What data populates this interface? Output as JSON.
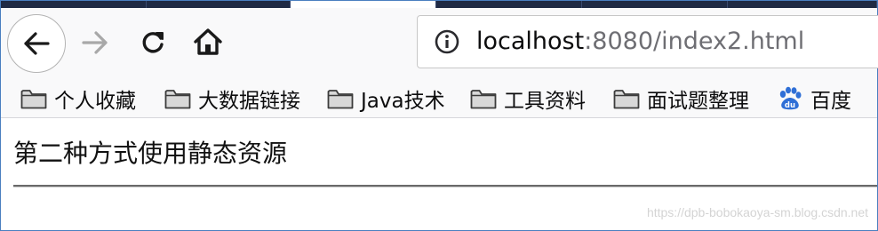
{
  "url": {
    "host": "localhost",
    "rest": ":8080/index2.html"
  },
  "nav": {
    "back_icon": "arrow-left-icon",
    "forward_icon": "arrow-right-icon",
    "reload_icon": "reload-icon",
    "home_icon": "home-icon",
    "info_icon": "info-icon"
  },
  "bookmarks": [
    {
      "label": "个人收藏",
      "icon": "folder-icon"
    },
    {
      "label": "大数据链接",
      "icon": "folder-icon"
    },
    {
      "label": "Java技术",
      "icon": "folder-icon"
    },
    {
      "label": "工具资料",
      "icon": "folder-icon"
    },
    {
      "label": "面试题整理",
      "icon": "folder-icon"
    },
    {
      "label": "百度",
      "icon": "baidu-paw-icon"
    }
  ],
  "page": {
    "heading": "第二种方式使用静态资源",
    "watermark": "https://dpb-bobokaoya-sm.blog.csdn.net"
  },
  "colors": {
    "tabstrip": "#1f2a44",
    "toolbar": "#f9f9fa",
    "frame_border": "#4a7fc0",
    "baidu_blue": "#2f6fd6"
  }
}
